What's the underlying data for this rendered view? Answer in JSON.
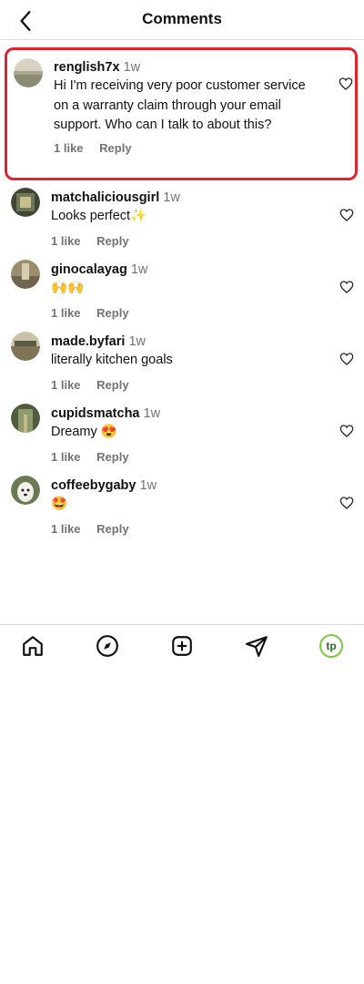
{
  "header": {
    "title": "Comments",
    "back_icon": "chevron-left-icon"
  },
  "comments": [
    {
      "username": "renglish7x",
      "time": "1w",
      "text": "Hi I'm receiving very poor customer service on a warranty claim through your email support. Who can I talk to about this?",
      "likes": "1 like",
      "reply": "Reply",
      "avatar_color": "#b7b29a"
    },
    {
      "username": "matchaliciousgirl",
      "time": "1w",
      "text": "Looks perfect✨",
      "likes": "1 like",
      "reply": "Reply",
      "avatar_color": "#4b4f3a"
    },
    {
      "username": "ginocalayag",
      "time": "1w",
      "text": "🙌🙌",
      "likes": "1 like",
      "reply": "Reply",
      "avatar_color": "#8b7f66"
    },
    {
      "username": "made.byfari",
      "time": "1w",
      "text": "literally kitchen goals",
      "likes": "1 like",
      "reply": "Reply",
      "avatar_color": "#9a8f6f"
    },
    {
      "username": "cupidsmatcha",
      "time": "1w",
      "text": "Dreamy 😍",
      "likes": "1 like",
      "reply": "Reply",
      "avatar_color": "#5c6a49"
    },
    {
      "username": "coffeebygaby",
      "time": "1w",
      "text": "🤩",
      "likes": "1 like",
      "reply": "Reply",
      "avatar_color": "#6b6a66"
    }
  ],
  "nav": {
    "items": [
      "home-icon",
      "explore-icon",
      "create-icon",
      "send-icon",
      "profile-avatar"
    ],
    "profile_text": "tp",
    "accent": "#7ac943"
  },
  "colors": {
    "highlight_border": "#e0242f"
  }
}
